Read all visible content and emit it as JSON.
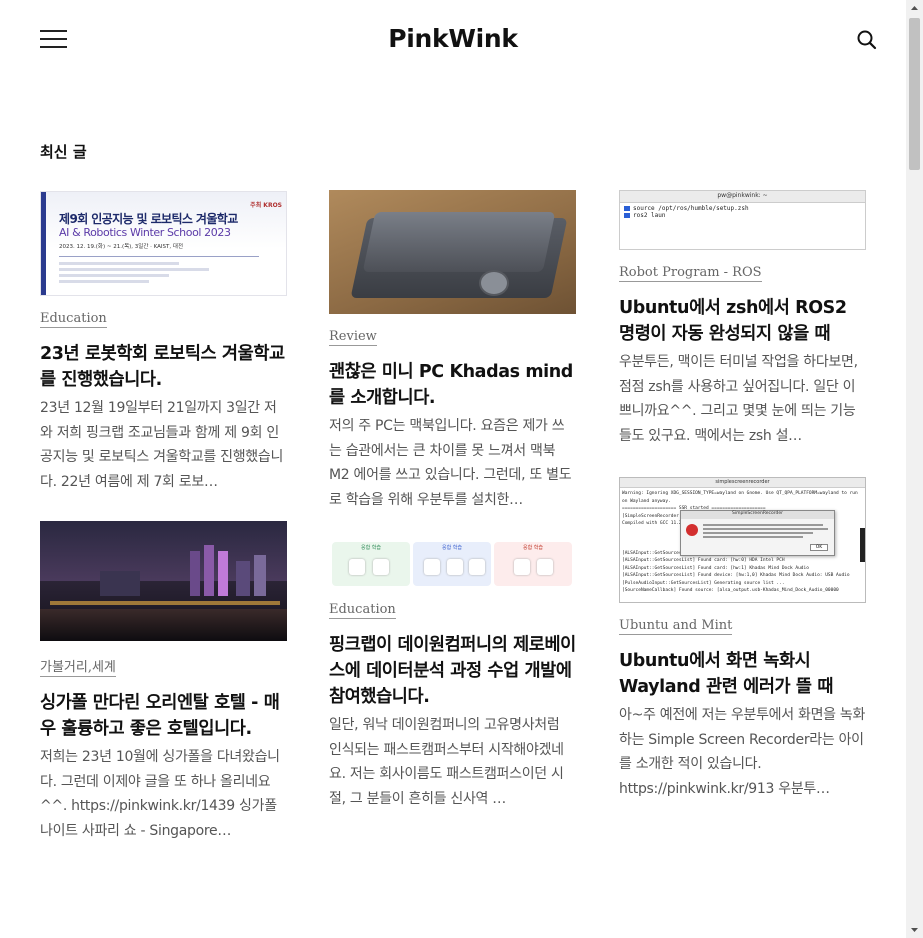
{
  "site": {
    "title": "PinkWink"
  },
  "section": {
    "title": "최신 글"
  },
  "posts": [
    {
      "category": "Education",
      "title": "23년 로봇학회 로보틱스 겨울학교를 진행했습니다.",
      "excerpt": "23년 12월 19일부터 21일까지 3일간 저와 저희 핑크랩 조교님들과 함께 제 9회 인공지능 및 로보틱스 겨울학교를 진행했습니다. 22년 여름에 제 7회 로보…",
      "thumb": {
        "badge": "주최 KROS",
        "heading": "제9회 인공지능 및 로보틱스 겨울학교",
        "subheading": "AI & Robotics Winter School 2023",
        "date": "2023. 12. 19.(화) ~ 21.(목), 3일간 · KAIST, 대전"
      }
    },
    {
      "category": "Review",
      "title": "괜찮은 미니 PC Khadas mind를 소개합니다.",
      "excerpt": "저의 주 PC는 맥북입니다. 요즘은 제가 쓰는 습관에서는 큰 차이를 못 느껴서 맥북 M2 에어를 쓰고 있습니다. 그런데, 또 별도로 학습을 위해 우분투를 설치한…"
    },
    {
      "category": "Robot Program - ROS",
      "title": "Ubuntu에서 zsh에서 ROS2 명령이 자동 완성되지 않을 때",
      "excerpt": "우분투든, 맥이든 터미널 작업을 하다보면, 점점 zsh를 사용하고 싶어집니다. 일단 이쁘니까요^^. 그리고 몇몇 눈에 띄는 기능들도 있구요. 맥에서는 zsh 설…",
      "thumb": {
        "window_title": "pw@pinkwink: ~",
        "lines": [
          "source /opt/ros/humble/setup.zsh",
          "ros2 laun"
        ]
      }
    },
    {
      "category": "가볼거리,세계",
      "title": "싱가폴 만다린 오리엔탈 호텔 - 매우 훌륭하고 좋은 호텔입니다.",
      "excerpt": "저희는 23년 10월에 싱가폴을 다녀왔습니다. 그런데 이제야 글을 또 하나 올리네요^^. https://pinkwink.kr/1439 싱가폴 나이트 사파리 쇼 - Singapore…"
    },
    {
      "category": "Education",
      "title": "핑크랩이 데이원컴퍼니의 제로베이스에 데이터분석 과정 수업 개발에 참여했습니다.",
      "excerpt": "일단, 워낙 데이원컴퍼니의 고유명사처럼 인식되는 패스트캠퍼스부터 시작해야겠네요. 저는 회사이름도 패스트캠퍼스이던 시절, 그 분들이 흔히들 신사역 …",
      "thumb": {
        "groups": [
          "응합 학습",
          "응합 학습",
          "응합 학습"
        ]
      }
    },
    {
      "category": "Ubuntu and Mint",
      "title": "Ubuntu에서 화면 녹화시 Wayland 관련 에러가 뜰 때",
      "excerpt": "아~주 예전에 저는 우분투에서 화면을 녹화하는 Simple Screen Recorder라는 아이를 소개한 적이 있습니다. https://pinkwink.kr/913 우분투…",
      "thumb": {
        "window_title": "simplescreenrecorder",
        "dialog_title": "SimpleScreenRecorder",
        "dialog_button": "OK",
        "lines": [
          "Warning: Ignoring XDG_SESSION_TYPE=wayland on Gnome. Use QT_QPA_PLATFORM=wayland to run",
          "on Wayland anyway.",
          "==================== SSR started ====================",
          "[SimpleScreenRecorder 0.4.4]",
          "Compiled with GCC 11.2.0",
          "[ALSAInput::GetSourcesList] Generating source list ...",
          "[ALSAInput::GetSourcesList] Found card: [hw:0] HDA Intel PCH",
          "[ALSAInput::GetSourcesList] Found card: [hw:1] Khadas Mind Dock Audio",
          "[ALSAInput::GetSourcesList] Found device: [hw:1,0] Khadas Mind Dock Audio: USB Audio",
          "[PulseAudioInput::GetSourcesList] Generating source list ...",
          "[SourceNameCallback] Found source: [alsa_output.usb-Khadas_Mind_Dock_Audio_00000"
        ]
      }
    }
  ],
  "colors": {
    "category": "#666666",
    "title": "#111111",
    "excerpt": "#555555",
    "scrollbar_thumb": "#c1c1c1"
  },
  "icons": {
    "menu": "hamburger-icon",
    "search": "search-icon"
  }
}
